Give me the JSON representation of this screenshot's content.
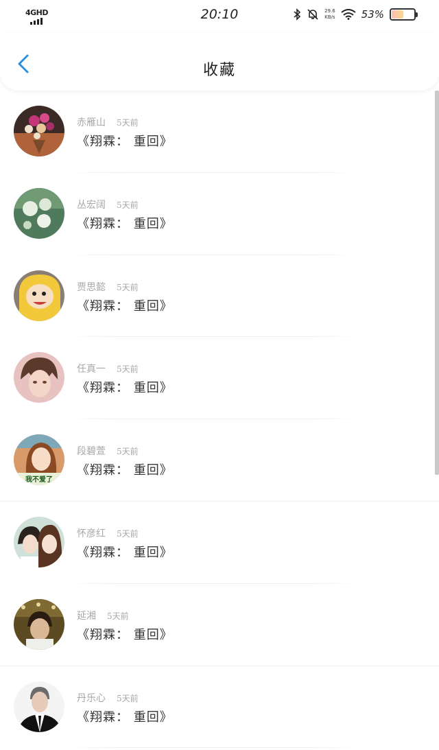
{
  "status_bar": {
    "network": "4GHD",
    "time": "20:10",
    "speed_value": "29.6",
    "speed_unit": "KB/s",
    "battery_percent": "53%",
    "battery_level": 0.53
  },
  "header": {
    "title": "收藏",
    "back_icon": "chevron-left-icon",
    "accent_color": "#2b8fe0"
  },
  "items": [
    {
      "name": "赤雁山",
      "time": "5天前",
      "content": "《翔霖： 重回》",
      "avatar": "flower-bouquet"
    },
    {
      "name": "丛宏阔",
      "time": "5天前",
      "content": "《翔霖： 重回》",
      "avatar": "white-flowers"
    },
    {
      "name": "贾思懿",
      "time": "5天前",
      "content": "《翔霖： 重回》",
      "avatar": "cartoon-boy-yellow-hood"
    },
    {
      "name": "任真一",
      "time": "5天前",
      "content": "《翔霖： 重回》",
      "avatar": "anime-character"
    },
    {
      "name": "段碧萱",
      "time": "5天前",
      "content": "《翔霖： 重回》",
      "avatar": "girl-photo-caption"
    },
    {
      "name": "怀彦红",
      "time": "5天前",
      "content": "《翔霖： 重回》",
      "avatar": "couple-photo"
    },
    {
      "name": "延湘",
      "time": "5天前",
      "content": "《翔霖： 重回》",
      "avatar": "vintage-portrait"
    },
    {
      "name": "丹乐心",
      "time": "5天前",
      "content": "《翔霖： 重回》",
      "avatar": "man-in-suit"
    }
  ],
  "avatar_caption": "我不爱了"
}
